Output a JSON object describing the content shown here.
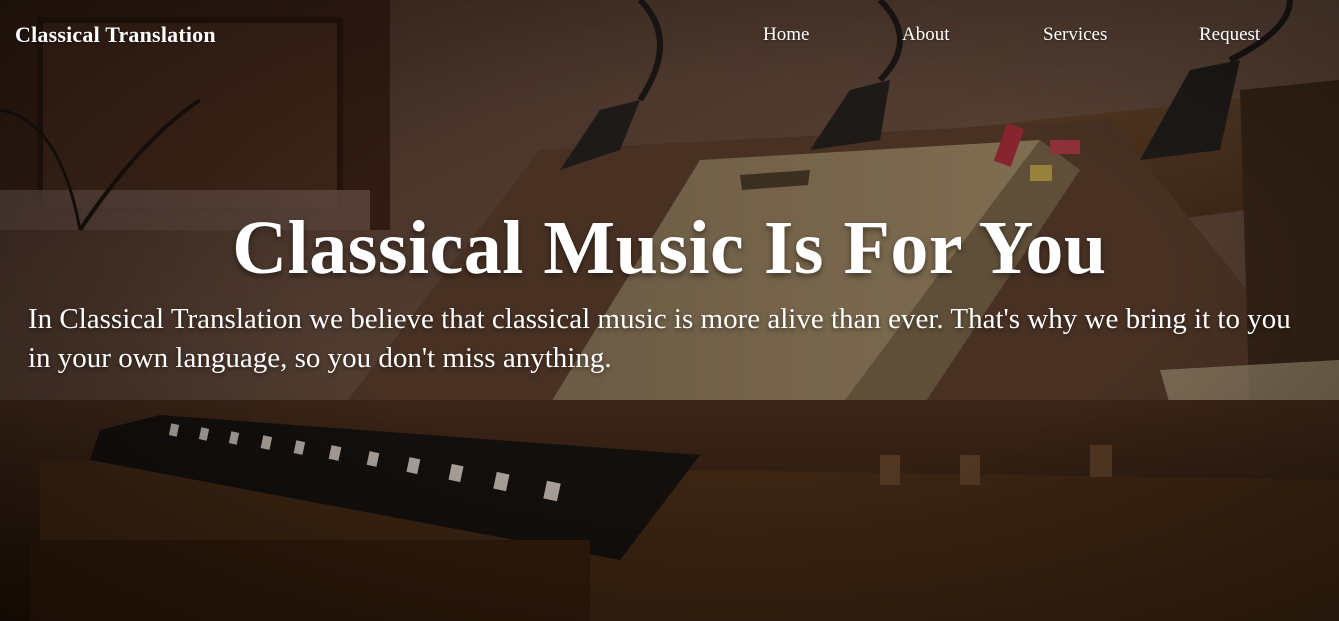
{
  "navbar": {
    "brand": "Classical Translation",
    "links": [
      {
        "label": "Home"
      },
      {
        "label": "About"
      },
      {
        "label": "Services"
      },
      {
        "label": "Request"
      }
    ]
  },
  "hero": {
    "title": "Classical Music Is For You",
    "text": "In Classical Translation we believe that classical music is more alive than ever. That's why we bring it to you in your own language, so you don't miss anything."
  }
}
